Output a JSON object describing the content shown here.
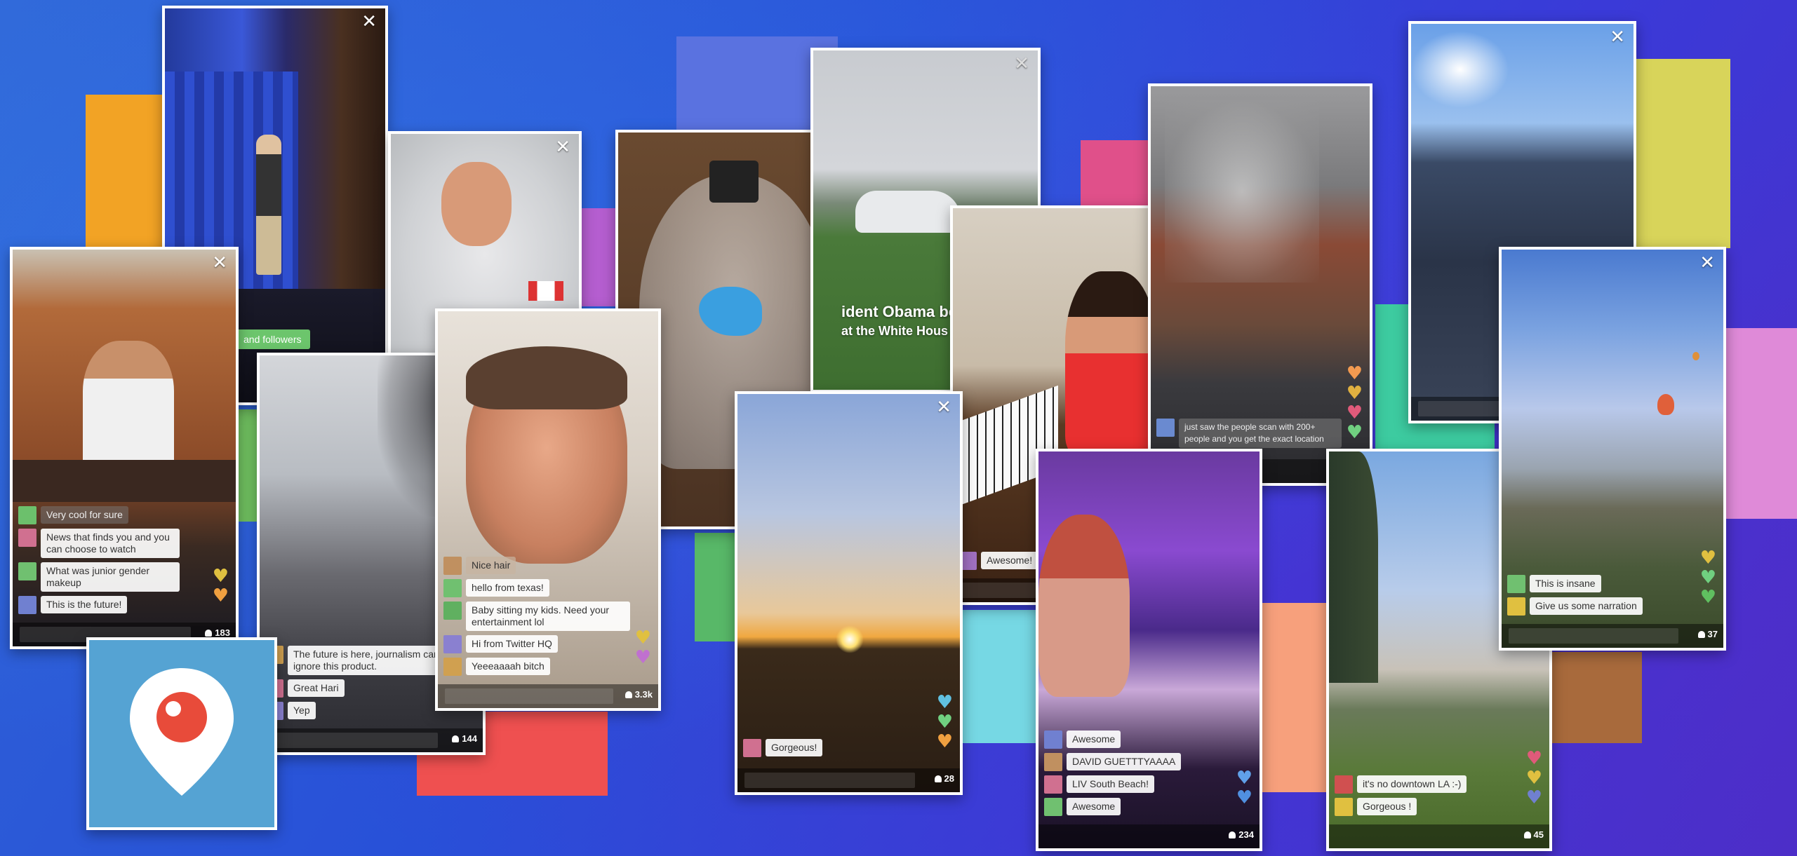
{
  "colors": {
    "periscope_blue": "#55a3d3",
    "periscope_red": "#e84b3a",
    "card_border": "#ffffff"
  },
  "logo": {
    "name": "periscope-logo-icon"
  },
  "cards": {
    "c1": {
      "viewers": "183",
      "close": "✕",
      "comments": [
        {
          "user": "",
          "text": "Very cool for sure"
        },
        {
          "user": "",
          "text": "News that finds you  and you can choose to watch"
        },
        {
          "user": "",
          "text": "What was junior gender makeup"
        },
        {
          "user": "",
          "text": "This is the future!"
        }
      ]
    },
    "c2": {
      "close": "✕",
      "follow_label": "and followers"
    },
    "c3": {
      "close": "✕"
    },
    "c4": {
      "viewers": "144",
      "comments": [
        {
          "user": "",
          "text": "The future is here, journalism can't ignore this product."
        },
        {
          "user": "",
          "text": "Great Hari"
        },
        {
          "user": "",
          "text": "Yep"
        }
      ]
    },
    "c5": {
      "viewers": "3.3k",
      "comments": [
        {
          "user": "",
          "text": "Nice hair"
        },
        {
          "user": "",
          "text": "hello from texas!"
        },
        {
          "user": "",
          "text": "Baby sitting my kids. Need your entertainment lol"
        },
        {
          "user": "",
          "text": "Hi from Twitter HQ"
        },
        {
          "user": "",
          "text": "Yeeeaaaah bitch"
        }
      ]
    },
    "c7": {
      "close": "✕",
      "caption": "ident Obama boa",
      "caption2": "at the White Hous"
    },
    "c8": {
      "close": "✕",
      "viewers": "28",
      "comments": [
        {
          "user": "",
          "text": "Gorgeous!"
        }
      ]
    },
    "c9": {
      "comments": [
        {
          "user": "",
          "text": "Awesome!"
        }
      ]
    },
    "c10": {
      "comments": [
        {
          "user": "",
          "text": "just saw the people scan with 200+ people and you get the exact location"
        }
      ]
    },
    "c11": {
      "viewers": "234",
      "comments": [
        {
          "user": "",
          "text": "Awesome"
        },
        {
          "user": "",
          "text": "DAVID GUETTTYAAAA"
        },
        {
          "user": "",
          "text": "LIV South Beach!"
        },
        {
          "user": "",
          "text": "Awesome"
        }
      ]
    },
    "c12": {
      "close": "✕"
    },
    "c13": {
      "close": "✕",
      "viewers": "37",
      "comments": [
        {
          "user": "",
          "text": "This is insane"
        },
        {
          "user": "",
          "text": "Give us some narration"
        }
      ]
    },
    "c14": {
      "viewers": "45",
      "comments": [
        {
          "user": "",
          "text": "it's no downtown LA :-)"
        },
        {
          "user": "",
          "text": "Gorgeous !"
        }
      ]
    }
  }
}
